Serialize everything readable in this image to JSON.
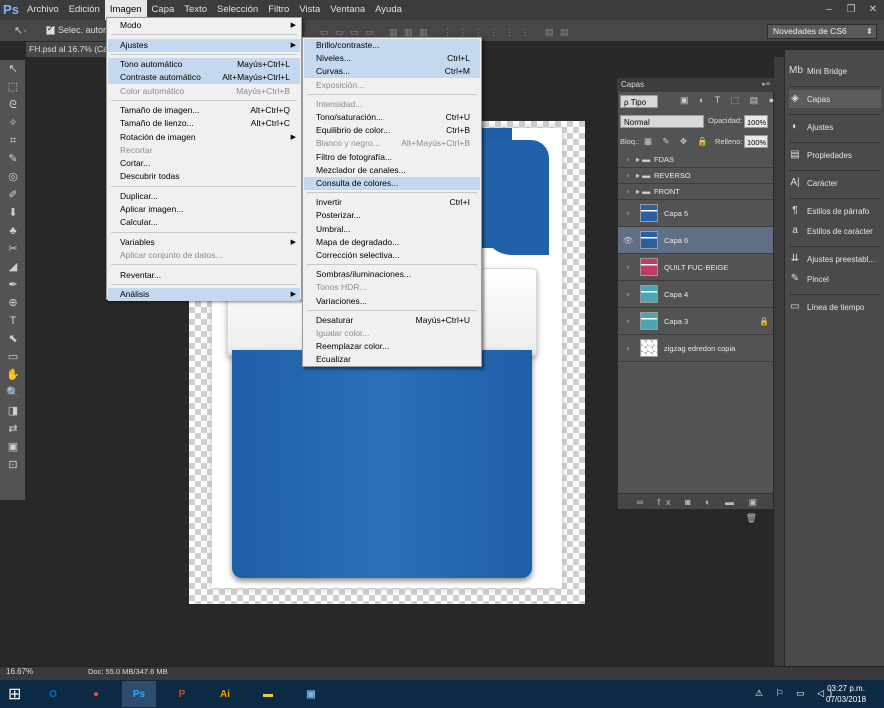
{
  "app": {
    "logo": "Ps",
    "menu": [
      "Archivo",
      "Edición",
      "Imagen",
      "Capa",
      "Texto",
      "Selección",
      "Filtro",
      "Vista",
      "Ventana",
      "Ayuda"
    ],
    "active_menu": "Imagen",
    "window_controls": [
      "–",
      "❐",
      "✕"
    ]
  },
  "options": {
    "autoselect_label": "Selec. autom.:",
    "workspace": "Novedades de CS6",
    "tool_glyph": "↖·"
  },
  "doc": {
    "tab": "FH.psd al 16.7% (Cap"
  },
  "toolbar": [
    "↖",
    "⬚",
    "ᘓ",
    "✧",
    "⌗",
    "✎",
    "◎",
    "✐",
    "⬇",
    "♣",
    "✂",
    "◢",
    "✒",
    "⊕",
    "T",
    "⬉",
    "▭",
    "✋",
    "🔍",
    "◨",
    "⇄",
    "▣",
    "⊡"
  ],
  "imagen_menu": [
    {
      "label": "Modo",
      "shortcut": "",
      "arrow": true,
      "disabled": false,
      "hl": false
    },
    {
      "sep": true
    },
    {
      "label": "Ajustes",
      "shortcut": "",
      "arrow": true,
      "disabled": false,
      "hl": true
    },
    {
      "sep": true
    },
    {
      "label": "Tono automático",
      "shortcut": "Mayús+Ctrl+L",
      "disabled": false,
      "hl": true
    },
    {
      "label": "Contraste automático",
      "shortcut": "Alt+Mayús+Ctrl+L",
      "disabled": false,
      "hl": true
    },
    {
      "label": "Color automático",
      "shortcut": "Mayús+Ctrl+B",
      "disabled": true,
      "hl": false
    },
    {
      "sep": true
    },
    {
      "label": "Tamaño de imagen...",
      "shortcut": "Alt+Ctrl+Q",
      "disabled": false,
      "hl": false
    },
    {
      "label": "Tamaño de lienzo...",
      "shortcut": "Alt+Ctrl+C",
      "disabled": false,
      "hl": false
    },
    {
      "label": "Rotación de imagen",
      "shortcut": "",
      "arrow": true,
      "disabled": false,
      "hl": false
    },
    {
      "label": "Recortar",
      "shortcut": "",
      "disabled": true,
      "hl": false
    },
    {
      "label": "Cortar...",
      "shortcut": "",
      "disabled": false,
      "hl": false
    },
    {
      "label": "Descubrir todas",
      "shortcut": "",
      "disabled": false,
      "hl": false
    },
    {
      "sep": true
    },
    {
      "label": "Duplicar...",
      "shortcut": "",
      "disabled": false,
      "hl": false
    },
    {
      "label": "Aplicar imagen...",
      "shortcut": "",
      "disabled": false,
      "hl": false
    },
    {
      "label": "Calcular...",
      "shortcut": "",
      "disabled": false,
      "hl": false
    },
    {
      "sep": true
    },
    {
      "label": "Variables",
      "shortcut": "",
      "arrow": true,
      "disabled": false,
      "hl": false
    },
    {
      "label": "Aplicar conjunto de datos...",
      "shortcut": "",
      "disabled": true,
      "hl": false
    },
    {
      "sep": true
    },
    {
      "label": "Reventar...",
      "shortcut": "",
      "disabled": false,
      "hl": false
    },
    {
      "sep": true
    },
    {
      "label": "Análisis",
      "shortcut": "",
      "arrow": true,
      "disabled": false,
      "hl": true
    }
  ],
  "ajustes_menu": [
    {
      "label": "Brillo/contraste...",
      "shortcut": "",
      "disabled": false,
      "hl": true
    },
    {
      "label": "Niveles...",
      "shortcut": "Ctrl+L",
      "disabled": false,
      "hl": true
    },
    {
      "label": "Curvas...",
      "shortcut": "Ctrl+M",
      "disabled": false,
      "hl": true
    },
    {
      "label": "Exposición...",
      "shortcut": "",
      "disabled": true,
      "hl": false
    },
    {
      "sep": true
    },
    {
      "label": "Intensidad...",
      "shortcut": "",
      "disabled": true,
      "hl": false
    },
    {
      "label": "Tono/saturación...",
      "shortcut": "Ctrl+U",
      "disabled": false,
      "hl": false
    },
    {
      "label": "Equilibrio de color...",
      "shortcut": "Ctrl+B",
      "disabled": false,
      "hl": false
    },
    {
      "label": "Blanco y negro...",
      "shortcut": "Alt+Mayús+Ctrl+B",
      "disabled": true,
      "hl": false
    },
    {
      "label": "Filtro de fotografía...",
      "shortcut": "",
      "disabled": false,
      "hl": false
    },
    {
      "label": "Mezclador de canales...",
      "shortcut": "",
      "disabled": false,
      "hl": false
    },
    {
      "label": "Consulta de colores...",
      "shortcut": "",
      "disabled": false,
      "hl": true
    },
    {
      "sep": true
    },
    {
      "label": "Invertir",
      "shortcut": "Ctrl+I",
      "disabled": false,
      "hl": false
    },
    {
      "label": "Posterizar...",
      "shortcut": "",
      "disabled": false,
      "hl": false
    },
    {
      "label": "Umbral...",
      "shortcut": "",
      "disabled": false,
      "hl": false
    },
    {
      "label": "Mapa de degradado...",
      "shortcut": "",
      "disabled": false,
      "hl": false
    },
    {
      "label": "Corrección selectiva...",
      "shortcut": "",
      "disabled": false,
      "hl": false
    },
    {
      "sep": true
    },
    {
      "label": "Sombras/iluminaciones...",
      "shortcut": "",
      "disabled": false,
      "hl": false
    },
    {
      "label": "Tonos HDR...",
      "shortcut": "",
      "disabled": true,
      "hl": false
    },
    {
      "label": "Variaciones...",
      "shortcut": "",
      "disabled": false,
      "hl": false
    },
    {
      "sep": true
    },
    {
      "label": "Desaturar",
      "shortcut": "Mayús+Ctrl+U",
      "disabled": false,
      "hl": false
    },
    {
      "label": "Igualar color...",
      "shortcut": "",
      "disabled": true,
      "hl": false
    },
    {
      "label": "Reemplazar color...",
      "shortcut": "",
      "disabled": false,
      "hl": false
    },
    {
      "label": "Ecualizar",
      "shortcut": "",
      "disabled": false,
      "hl": false
    }
  ],
  "layers": {
    "title": "Capas",
    "filter": "ρ Tipo",
    "mode": "Normal",
    "opacity_label": "Opacidad:",
    "opacity": "100%",
    "lock_label": "Bloq.:",
    "fill_label": "Relleno:",
    "fill": "100%",
    "filter_icons": "▣ ◐ T ⬚ ▤ ●",
    "lock_icons": "▦ ✎ ✥ 🔒",
    "footer_icons": "∞ fx ◙ ◐ ▬ ▣ 🗑",
    "items": [
      {
        "name": "FDAS",
        "type": "group",
        "selected": false,
        "visible": false,
        "color": "",
        "lock": ""
      },
      {
        "name": "REVERSO",
        "type": "group",
        "selected": false,
        "visible": false,
        "color": "",
        "lock": ""
      },
      {
        "name": "FRONT",
        "type": "group",
        "selected": false,
        "visible": false,
        "color": "",
        "lock": ""
      },
      {
        "name": "Capa 5",
        "type": "layer",
        "selected": false,
        "visible": false,
        "color": "#2a5fa2",
        "lock": ""
      },
      {
        "name": "Capa 6",
        "type": "layer",
        "selected": true,
        "visible": true,
        "color": "#2a5fa2",
        "lock": ""
      },
      {
        "name": "QUILT FUC-BEIGE",
        "type": "layer",
        "selected": false,
        "visible": false,
        "color": "#c23a5f",
        "lock": ""
      },
      {
        "name": "Capa 4",
        "type": "layer",
        "selected": false,
        "visible": false,
        "color": "#4ca5b3",
        "lock": ""
      },
      {
        "name": "Capa 3",
        "type": "layer",
        "selected": false,
        "visible": false,
        "color": "#4ca5b3",
        "lock": "🔒"
      },
      {
        "name": "zigzag edredon copia",
        "type": "layer",
        "selected": false,
        "visible": false,
        "color": "checker",
        "lock": ""
      }
    ]
  },
  "panels": [
    {
      "label": "Mini Bridge",
      "icon": "Mb",
      "selected": false
    },
    {
      "label": "Capas",
      "icon": "◈",
      "selected": true
    },
    {
      "label": "Ajustes",
      "icon": "◐",
      "selected": false
    },
    {
      "label": "Propiedades",
      "icon": "▤",
      "selected": false
    },
    {
      "label": "Carácter",
      "icon": "A|",
      "selected": false
    },
    {
      "label": "Estilos de párrafo",
      "icon": "¶",
      "selected": false
    },
    {
      "label": "Estilos de carácter",
      "icon": "a",
      "selected": false
    },
    {
      "label": "Ajustes preestabl...",
      "icon": "⇊",
      "selected": false
    },
    {
      "label": "Pincel",
      "icon": "✎",
      "selected": false
    },
    {
      "label": "Línea de tiempo",
      "icon": "▭",
      "selected": false
    }
  ],
  "status": {
    "zoom": "16.67%",
    "doc": "Doc: 55.0 MB/347.6 MB"
  },
  "taskbar": {
    "apps": [
      {
        "name": "outlook",
        "glyph": "O",
        "color": "#0072c6"
      },
      {
        "name": "chrome",
        "glyph": "●",
        "color": "#dd4b39"
      },
      {
        "name": "photoshop",
        "glyph": "Ps",
        "color": "#31a8ff"
      },
      {
        "name": "powerpoint",
        "glyph": "P",
        "color": "#d24726"
      },
      {
        "name": "illustrator",
        "glyph": "Ai",
        "color": "#ff9a00"
      },
      {
        "name": "explorer",
        "glyph": "▬",
        "color": "#f4c84a"
      },
      {
        "name": "photos",
        "glyph": "▣",
        "color": "#7ab4e6"
      }
    ],
    "tray": "⚠ ⚐ ▭ ◁)",
    "time": "03:27 p.m.",
    "date": "07/03/2018"
  }
}
